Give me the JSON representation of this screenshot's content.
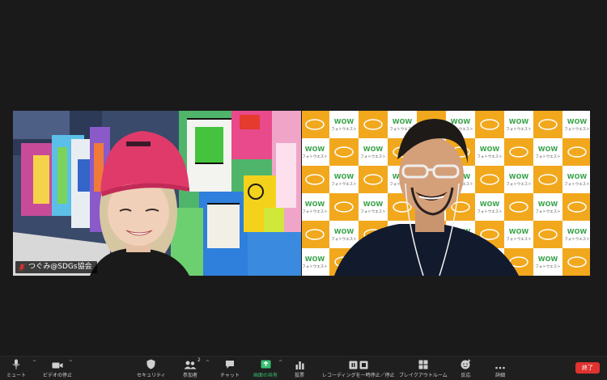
{
  "participants": [
    {
      "name": "つぐみ@SDGs協会",
      "muted": true
    },
    {
      "name": ""
    }
  ],
  "background_logo": {
    "line1": "WOW",
    "line2": "フォトウエスト"
  },
  "toolbar": {
    "mute": "ミュート",
    "video": "ビデオの停止",
    "security": "セキュリティ",
    "participants": "参加者",
    "participants_count": "2",
    "chat": "チャット",
    "share": "画面の共有",
    "polls": "投票",
    "recording": "レコーディングを一時停止／停止",
    "breakout": "ブレイクアウトルーム",
    "reactions": "反応",
    "more": "詳細",
    "end": "終了"
  },
  "colors": {
    "share_green": "#38c172",
    "end_red": "#e0322f",
    "backdrop_orange": "#f2a81d"
  }
}
